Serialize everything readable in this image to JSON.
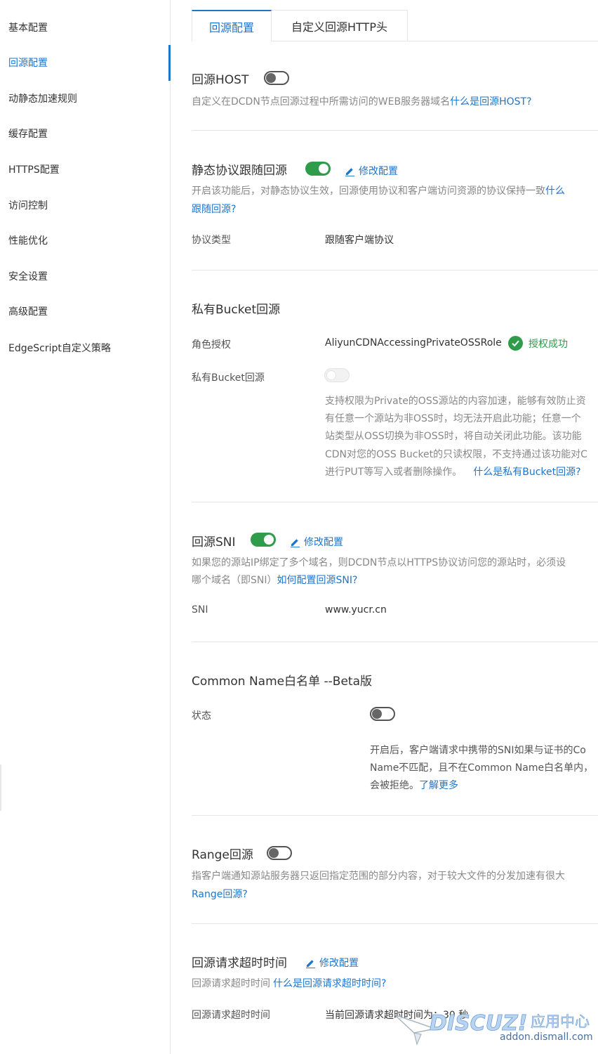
{
  "sidebar": {
    "items": [
      {
        "label": "基本配置"
      },
      {
        "label": "回源配置"
      },
      {
        "label": "动静态加速规则"
      },
      {
        "label": "缓存配置"
      },
      {
        "label": "HTTPS配置"
      },
      {
        "label": "访问控制"
      },
      {
        "label": "性能优化"
      },
      {
        "label": "安全设置"
      },
      {
        "label": "高级配置"
      },
      {
        "label": "EdgeScript自定义策略"
      }
    ],
    "active_item": "回源配置"
  },
  "tabs": [
    {
      "label": "回源配置",
      "active": true
    },
    {
      "label": "自定义回源HTTP头",
      "active": false
    }
  ],
  "edit_label": "修改配置",
  "sections": {
    "origin_host": {
      "title": "回源HOST",
      "enabled": false,
      "desc": "自定义在DCDN节点回源过程中所需访问的WEB服务器域名",
      "help_link": "什么是回源HOST?"
    },
    "static_protocol": {
      "title": "静态协议跟随回源",
      "enabled": true,
      "desc": "开启该功能后，对静态协议生效，回源使用协议和客户端访问资源的协议保持一致",
      "help_link_line1": "什么",
      "help_link_line2": "跟随回源?",
      "field_label": "协议类型",
      "field_value": "跟随客户端协议"
    },
    "private_bucket": {
      "title": "私有Bucket回源",
      "role_label": "角色授权",
      "role_value": "AliyunCDNAccessingPrivateOSSRole",
      "role_status": "授权成功",
      "toggle_label": "私有Bucket回源",
      "enabled": false,
      "desc_lines": [
        "支持权限为Private的OSS源站的内容加速，能够有效防止资",
        "有任意一个源站为非OSS时，均无法开启此功能；任意一个",
        "站类型从OSS切换为非OSS时，将自动关闭此功能。该功能",
        "CDN对您的OSS Bucket的只读权限，不支持通过该功能对C",
        "进行PUT等写入或者删除操作。"
      ],
      "help_link": "什么是私有Bucket回源?"
    },
    "origin_sni": {
      "title": "回源SNI",
      "enabled": true,
      "desc_line1": "如果您的源站IP绑定了多个域名，则DCDN节点以HTTPS协议访问您的源站时，必须设",
      "desc_line2": "哪个域名（即SNI）",
      "help_link": "如何配置回源SNI?",
      "field_label": "SNI",
      "field_value": "www.yucr.cn"
    },
    "common_name": {
      "title": "Common Name白名单 --Beta版",
      "status_label": "状态",
      "enabled": false,
      "desc_lines": [
        "开启后，客户端请求中携带的SNI如果与证书的Co",
        "Name不匹配，且不在Common Name白名单内，",
        "会被拒绝。"
      ],
      "help_link": "了解更多"
    },
    "range": {
      "title": "Range回源",
      "enabled": false,
      "desc": "指客户端通知源站服务器只返回指定范围的部分内容，对于较大文件的分发加速有很大",
      "help_link": "Range回源?"
    },
    "timeout": {
      "title": "回源请求超时时间",
      "desc": "回源请求超时时间",
      "help_link": "什么是回源请求超时时间?",
      "field_label": "回源请求超时时间",
      "field_value": "当前回源请求超时时间为：30 秒"
    }
  },
  "watermark": {
    "brand": "DISCUZ!",
    "tagline": "应用中心",
    "url": "addon.dismall.com"
  },
  "colors": {
    "link": "#1f74cc",
    "success": "#2e9c4a",
    "divider": "#e5e5e5",
    "muted": "#888888"
  }
}
